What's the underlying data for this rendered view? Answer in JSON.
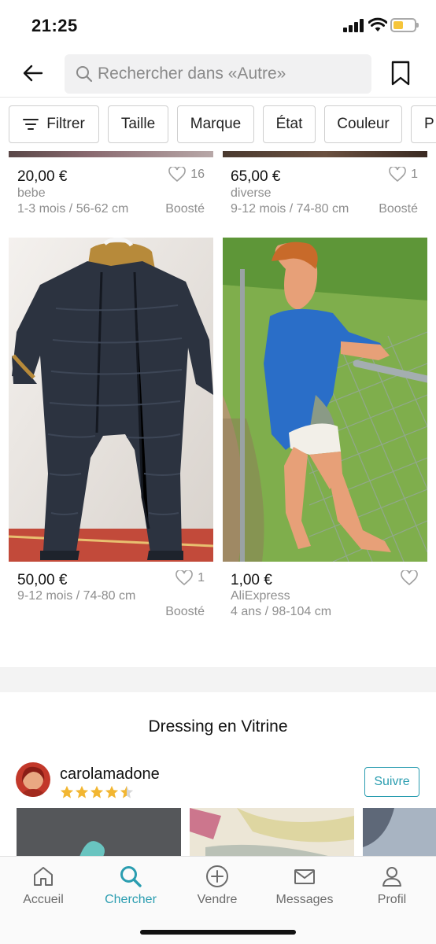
{
  "status": {
    "time": "21:25"
  },
  "search": {
    "placeholder": "Rechercher dans «Autre»"
  },
  "filters": [
    {
      "label": "Filtrer"
    },
    {
      "label": "Taille"
    },
    {
      "label": "Marque"
    },
    {
      "label": "État"
    },
    {
      "label": "Couleur"
    },
    {
      "label": "P"
    }
  ],
  "products": [
    {
      "price": "20,00 €",
      "likes": "16",
      "brand": "bebe",
      "size": "1-3 mois / 56-62 cm",
      "badge": "Boosté"
    },
    {
      "price": "65,00 €",
      "likes": "1",
      "brand": "diverse",
      "size": "9-12 mois / 74-80 cm",
      "badge": "Boosté"
    },
    {
      "price": "50,00 €",
      "likes": "1",
      "brand": "",
      "size": "9-12 mois / 74-80 cm",
      "badge": "Boosté"
    },
    {
      "price": "1,00 €",
      "likes": "",
      "brand": "AliExpress",
      "size": "4 ans / 98-104 cm",
      "badge": ""
    }
  ],
  "showcase": {
    "title": "Dressing en Vitrine",
    "username": "carolamadone",
    "rating": 4.5,
    "follow_label": "Suivre"
  },
  "tabs": [
    {
      "label": "Accueil",
      "icon": "home-icon"
    },
    {
      "label": "Chercher",
      "icon": "search-icon",
      "active": true
    },
    {
      "label": "Vendre",
      "icon": "plus-circle-icon"
    },
    {
      "label": "Messages",
      "icon": "mail-icon"
    },
    {
      "label": "Profil",
      "icon": "user-icon"
    }
  ],
  "colors": {
    "accent": "#2a9db0",
    "star": "#f2b632"
  }
}
